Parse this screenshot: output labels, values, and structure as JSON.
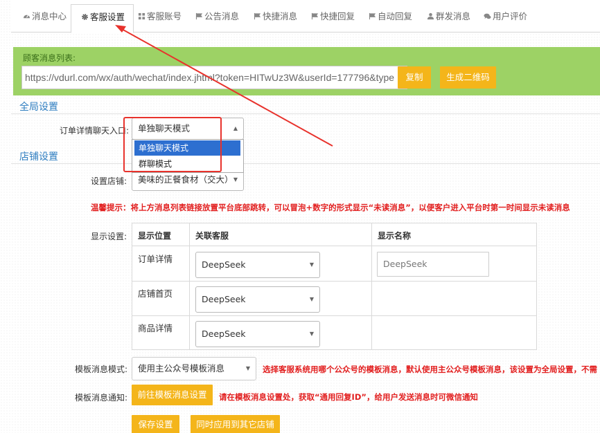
{
  "tabs": [
    {
      "label": "消息中心",
      "icon": "dashboard-icon"
    },
    {
      "label": "客服设置",
      "icon": "gear-icon",
      "active": true
    },
    {
      "label": "客服账号",
      "icon": "grid-icon"
    },
    {
      "label": "公告消息",
      "icon": "flag-icon"
    },
    {
      "label": "快捷消息",
      "icon": "flag-icon"
    },
    {
      "label": "快捷回复",
      "icon": "flag-icon"
    },
    {
      "label": "自动回复",
      "icon": "flag-icon"
    },
    {
      "label": "群发消息",
      "icon": "user-icon"
    },
    {
      "label": "用户评价",
      "icon": "comments-icon"
    }
  ],
  "url_box": {
    "label": "顾客消息列表:",
    "url": "https://vdurl.com/wx/auth/wechat/index.jhtml?token=HITwUz3W&userId=177796&type",
    "copy_label": "复制",
    "qr_label": "生成二维码"
  },
  "global": {
    "title": "全局设置",
    "chat_entry_label": "订单详情聊天入口:",
    "chat_entry_value": "单独聊天模式",
    "options": [
      "单独聊天模式",
      "群聊模式"
    ]
  },
  "shop": {
    "title": "店铺设置",
    "set_store_label": "设置店铺:",
    "store_value": "美味的正餐食材（交大）",
    "tip": "温馨提示：将上方消息列表链接放置平台底部跳转，可以冒泡+数字的形式显示“未读消息”，以便客户进入平台时第一时间显示未读消息",
    "display_label": "显示设置:",
    "table": {
      "headers": [
        "显示位置",
        "关联客服",
        "显示名称"
      ],
      "rows": [
        {
          "position": "订单详情",
          "agent": "DeepSeek",
          "name_placeholder": "DeepSeek"
        },
        {
          "position": "店铺首页",
          "agent": "DeepSeek"
        },
        {
          "position": "商品详情",
          "agent": "DeepSeek"
        }
      ]
    },
    "template_mode_label": "模板消息模式:",
    "template_mode_value": "使用主公众号模板消息",
    "template_mode_tip": "选择客服系统用哪个公众号的模板消息，默认使用主公众号模板消息，该设置为全局设置，不需",
    "template_notice_label": "模板消息通知:",
    "template_settings_btn": "前往模板消息设置",
    "template_notice_tip": "请在模板消息设置处，获取“通用回复ID”，给用户发送消息时可微信通知",
    "save_btn": "保存设置",
    "apply_all_btn": "同时应用到其它店铺"
  },
  "colors": {
    "accent": "#f4b51a",
    "green": "#9dd265",
    "highlight_red": "#e8322c",
    "selected_blue": "#2d6fd0",
    "warn_red": "#e21f1f"
  }
}
